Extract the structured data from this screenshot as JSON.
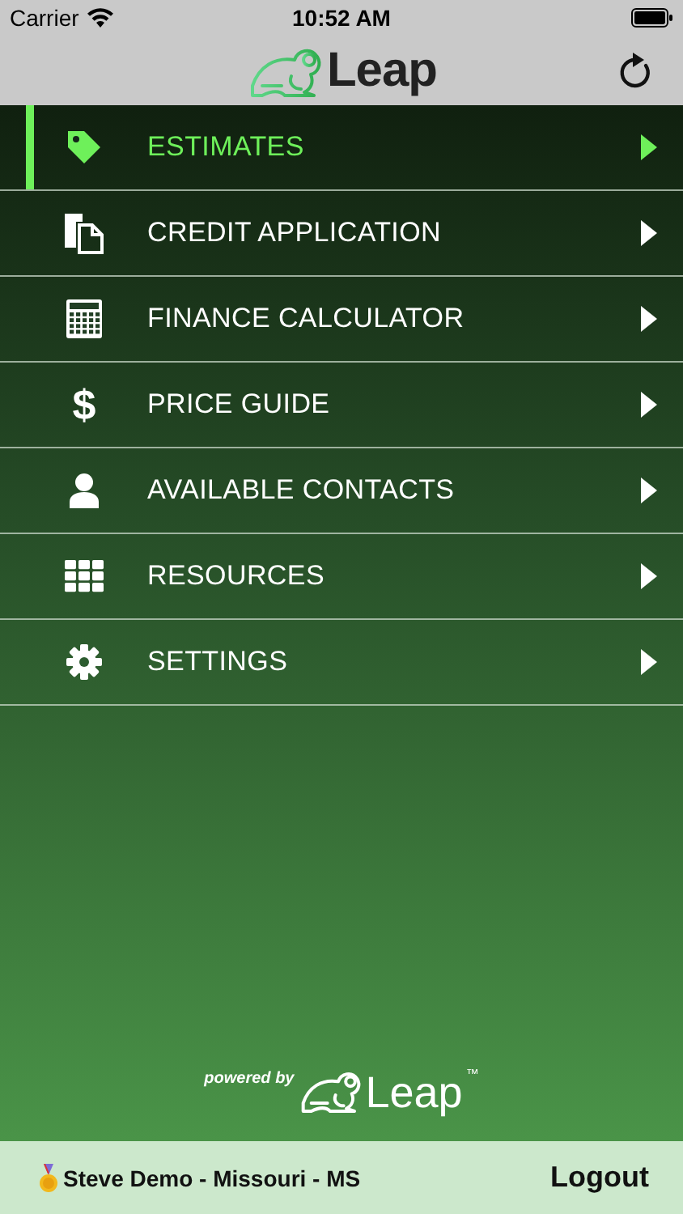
{
  "status_bar": {
    "carrier": "Carrier",
    "time": "10:52 AM"
  },
  "header": {
    "logo_text": "Leap"
  },
  "menu": [
    {
      "label": "ESTIMATES",
      "selected": true
    },
    {
      "label": "CREDIT APPLICATION",
      "selected": false
    },
    {
      "label": "FINANCE CALCULATOR",
      "selected": false
    },
    {
      "label": "PRICE GUIDE",
      "glyph": "$",
      "selected": false
    },
    {
      "label": "AVAILABLE CONTACTS",
      "selected": false
    },
    {
      "label": "RESOURCES",
      "selected": false
    },
    {
      "label": "SETTINGS",
      "selected": false
    }
  ],
  "powered_by": {
    "caption": "powered by",
    "logo_text": "Leap",
    "trademark": "™"
  },
  "footer": {
    "user": "Steve Demo - Missouri - MS",
    "logout": "Logout"
  }
}
